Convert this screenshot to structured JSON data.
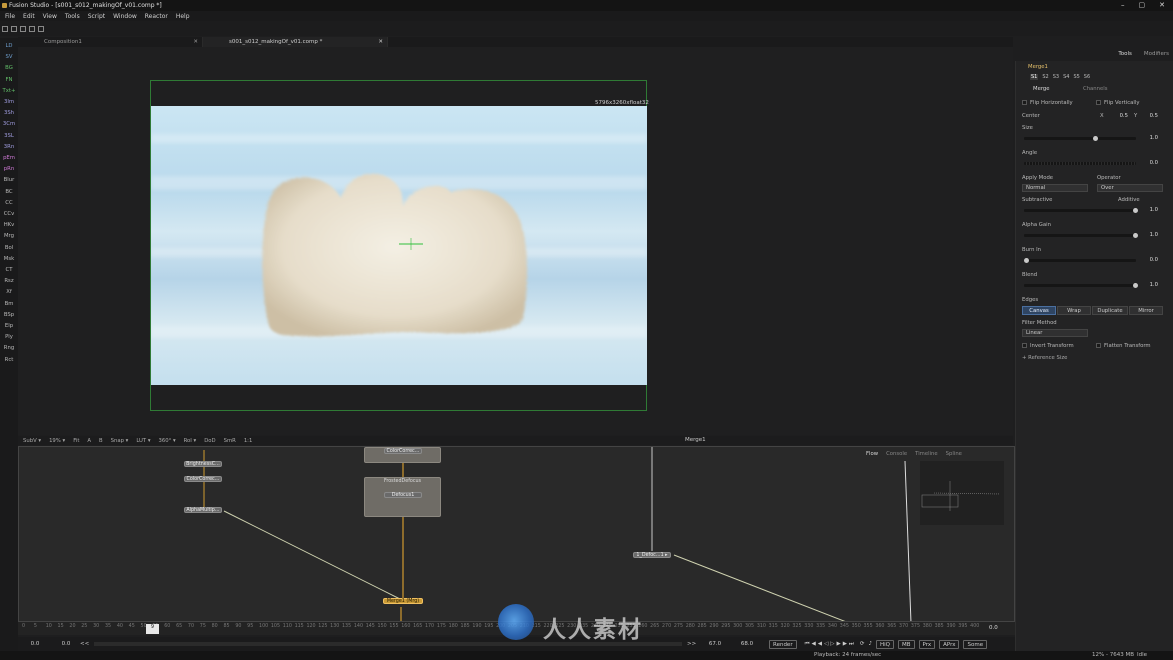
{
  "app": {
    "title": "Fusion Studio - [s001_s012_makingOf_v01.comp *]",
    "window_buttons": [
      "–",
      "▢",
      "✕"
    ]
  },
  "menu": [
    "File",
    "Edit",
    "View",
    "Tools",
    "Script",
    "Window",
    "Reactor",
    "Help"
  ],
  "left_tools": [
    "LD",
    "SV",
    "BG",
    "FN",
    "Txt+",
    "3Im",
    "3Sh",
    "3Cm",
    "3SL",
    "3Rn",
    "pEm",
    "pRn",
    "Blur",
    "BC",
    "CC",
    "CCv",
    "HKv",
    "Mrg",
    "Bol",
    "Msk",
    "CT",
    "Rsz",
    "Xf",
    "Bm",
    "BSp",
    "Elp",
    "Ply",
    "Rng",
    "Rct"
  ],
  "doc_tabs": [
    {
      "label": "Composition1",
      "close": "✕"
    },
    {
      "label": "s001_s012_makingOf_v01.comp *",
      "close": "✕"
    }
  ],
  "viewer": {
    "resolution_label": "5796x3260xfloat32",
    "toolbar": [
      "SubV ▾",
      "19% ▾",
      "Fit",
      "A",
      "B",
      "Snap ▾",
      "LUT ▾",
      "360° ▾",
      "RoI ▾",
      "DoD",
      "SmR",
      "1:1"
    ]
  },
  "flow": {
    "title": "Merge1",
    "tabs": [
      "Flow",
      "Console",
      "Timeline",
      "Spline"
    ],
    "nodes": [
      {
        "label": "BrightnessC…"
      },
      {
        "label": "ColorCorrec…"
      },
      {
        "label": "AlphaMultip…"
      },
      {
        "label": "ColorCorrec…"
      },
      {
        "label": "Defocus1"
      },
      {
        "label": "Merge1 (Mrg)"
      },
      {
        "label": "1_Defoc…1 ▸"
      }
    ],
    "group_label": "FrostedDefocus"
  },
  "timeline": {
    "ticks": [
      "0",
      "5",
      "10",
      "15",
      "20",
      "25",
      "30",
      "35",
      "40",
      "45",
      "50",
      "55",
      "60",
      "65",
      "70",
      "75",
      "80",
      "85",
      "90",
      "95",
      "100",
      "105",
      "110",
      "115",
      "120",
      "125",
      "130",
      "135",
      "140",
      "145",
      "150",
      "155",
      "160",
      "165",
      "170",
      "175",
      "180",
      "185",
      "190",
      "195",
      "200",
      "205",
      "210",
      "215",
      "220",
      "225",
      "230",
      "235",
      "240",
      "245",
      "250",
      "255",
      "260",
      "265",
      "270",
      "275",
      "280",
      "285",
      "290",
      "295",
      "300",
      "305",
      "310",
      "315",
      "320",
      "325",
      "330",
      "335",
      "340",
      "345",
      "350",
      "355",
      "360",
      "365",
      "370",
      "375",
      "380",
      "385",
      "390",
      "395",
      "400"
    ],
    "current_frame": "9",
    "range_end": "0.0"
  },
  "transport": {
    "start": "0.0",
    "render_start": "0.0",
    "prev": "<<",
    "next": ">>",
    "render_end": "67.0",
    "end": "68.0",
    "render_label": "Render",
    "buttons": [
      "HiQ",
      "MB",
      "Prx",
      "APrx",
      "Some"
    ]
  },
  "status": {
    "playback": "Playback: 24 frames/sec",
    "memory": "12% - 7643 MB",
    "state": "Idle"
  },
  "inspector": {
    "header_tabs": [
      "Tools",
      "Modifiers"
    ],
    "tool_name": "Merge1",
    "version_tabs": [
      "S1",
      "S2",
      "S3",
      "S4",
      "S5",
      "S6"
    ],
    "section_tabs": [
      "Merge",
      "Channels"
    ],
    "flip_h": "Flip Horizontally",
    "flip_v": "Flip Vertically",
    "center": {
      "label": "Center",
      "x_label": "X",
      "x": "0.5",
      "y_label": "Y",
      "y": "0.5"
    },
    "size": {
      "label": "Size",
      "value": "1.0",
      "level": 0.64
    },
    "angle": {
      "label": "Angle",
      "value": "0.0",
      "level": 0.5
    },
    "apply_mode": {
      "label": "Apply Mode",
      "value": "Normal"
    },
    "operator": {
      "label": "Operator",
      "value": "Over"
    },
    "subtractive_label": "Subtractive",
    "additive_label": "Additive",
    "subadd": {
      "value": "1.0",
      "level": 1.0
    },
    "alpha_gain": {
      "label": "Alpha Gain",
      "value": "1.0",
      "level": 1.0
    },
    "burn_in": {
      "label": "Burn In",
      "value": "0.0",
      "level": 0.0
    },
    "blend": {
      "label": "Blend",
      "value": "1.0",
      "level": 1.0
    },
    "edges": {
      "label": "Edges",
      "options": [
        "Canvas",
        "Wrap",
        "Duplicate",
        "Mirror"
      ],
      "selected": "Canvas"
    },
    "filter_method": {
      "label": "Filter Method",
      "value": "Linear"
    },
    "invert_transform": "Invert Transform",
    "flatten_transform": "Flatten Transform",
    "reference_size": "Reference Size"
  },
  "watermark": {
    "text": "人人素材"
  },
  "colors": {
    "accent_merge": "#c99a36",
    "frame_green": "#2f7a35",
    "edge_selected": "#2f4563"
  }
}
